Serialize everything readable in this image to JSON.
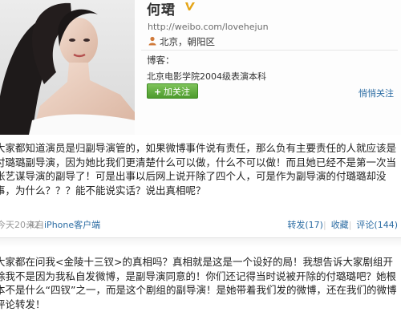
{
  "profile": {
    "name": "何珺",
    "url": "http://weibo.com/lovehejun",
    "location": "北京，朝阳区",
    "blog_label": "博客：",
    "bio": "北京电影学院2004级表演本科",
    "follow_plus": "+",
    "follow_label": "加关注",
    "mention_label": "悄悄关注",
    "verified_icon": "v-badge-icon",
    "location_icon": "person-location-icon"
  },
  "posts": [
    {
      "text": "大家都知道演员是归副导演管的，如果微博事件说有责任，那么负有主要责任的人就应该是付璐璐副导演，因为她比我们更清楚什么可以做，什么不可以做！而且她已经不是第一次当张艺谋导演的副导了！可是出事以后网上说开除了四个人，可是作为副导演的付璐璐却没事，为什么？？？能不能说实话？说出真相呢？",
      "time": "今天20:42",
      "from_prefix": "来自",
      "from_app": "iPhone客户端",
      "repost": "转发(17)",
      "favorite": "收藏",
      "comment": "评论(144)"
    },
    {
      "text": "大家都在问我<金陵十三钗>的真相吗？真相就是这是一个设好的局！我想告诉大家剧组开除我不是因为我私自发微博，是副导演同意的！你们还记得当时说被开除的付璐璐吧？她根本不是什么“四钗”之一，而是这个剧组的副导演！是她带着我们发的微博，还在我们的微博评论转发！"
    }
  ]
}
